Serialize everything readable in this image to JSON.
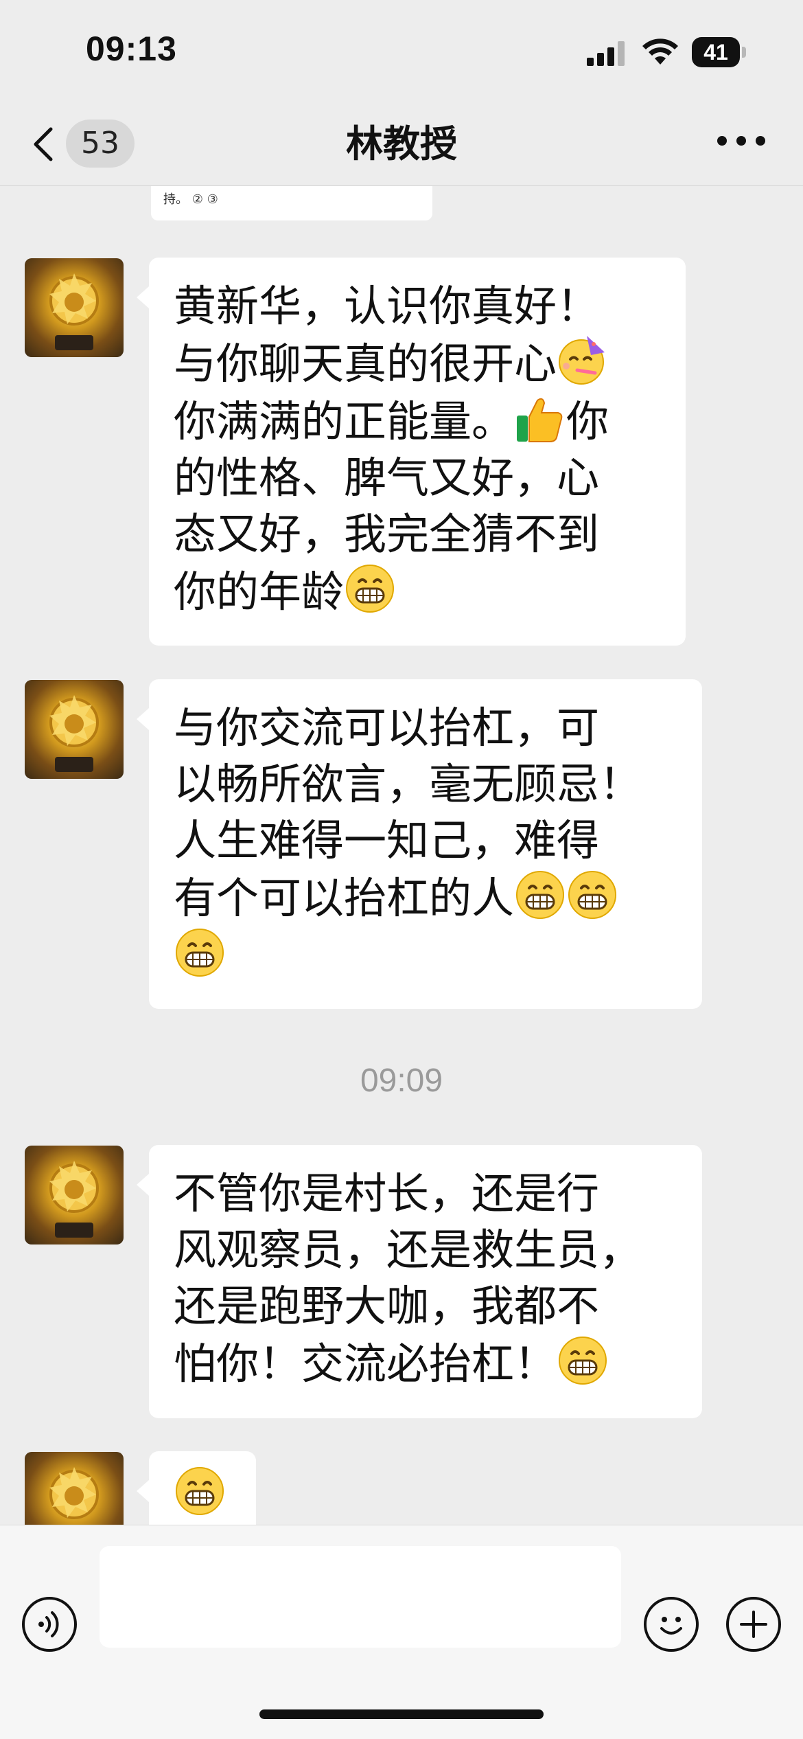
{
  "status_bar": {
    "time": "09:13",
    "battery": "41"
  },
  "nav": {
    "back_count": "53",
    "title": "林教授"
  },
  "quote": {
    "text": "持。 ② ③"
  },
  "messages": [
    {
      "segments": [
        {
          "t": "黄新华，认识你真好！\n与你聊天真的很开心"
        },
        {
          "e": "partying-face"
        },
        {
          "t": "\n你满满的正能量。"
        },
        {
          "e": "thumbs-up"
        },
        {
          "t": "你\n的性格、脾气又好，心\n态又好，我完全猜不到\n你的年龄"
        },
        {
          "e": "grinning-face"
        }
      ]
    },
    {
      "segments": [
        {
          "t": "与你交流可以抬杠，可\n以畅所欲言，毫无顾忌！\n人生难得一知己，难得\n有个可以抬杠的人"
        },
        {
          "e": "grinning-face"
        },
        {
          "e": "grinning-face"
        },
        {
          "t": "\n"
        },
        {
          "e": "grinning-face"
        }
      ]
    },
    {
      "segments": [
        {
          "t": "不管你是村长，还是行\n风观察员，还是救生员，\n还是跑野大咖，我都不\n怕你！交流必抬杠！"
        },
        {
          "e": "grinning-face"
        }
      ]
    },
    {
      "segments": [
        {
          "e": "grinning-face"
        }
      ]
    }
  ],
  "timestamp": "09:09",
  "input": {
    "placeholder": ""
  },
  "icons": {
    "back": "chevron-left-icon",
    "more": "more-dots-icon",
    "voice": "voice-icon",
    "emoji": "emoji-icon",
    "plus": "plus-icon"
  },
  "colors": {
    "background": "#ededed",
    "bubble": "#ffffff",
    "timestamp": "#9a9a9a"
  }
}
